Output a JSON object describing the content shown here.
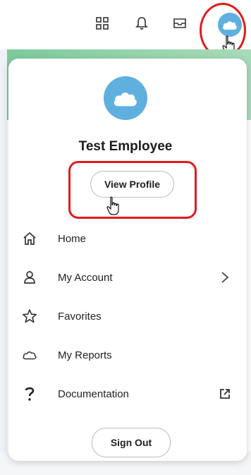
{
  "header": {
    "icons": [
      "apps-grid-icon",
      "bell-icon",
      "inbox-icon",
      "cloud-avatar-icon"
    ]
  },
  "profile": {
    "name": "Test Employee",
    "view_profile_label": "View Profile"
  },
  "menu": {
    "items": [
      {
        "label": "Home",
        "icon": "home-icon"
      },
      {
        "label": "My Account",
        "icon": "person-icon",
        "trailing": "chevron-right-icon"
      },
      {
        "label": "Favorites",
        "icon": "star-icon"
      },
      {
        "label": "My Reports",
        "icon": "cloud-outline-icon"
      },
      {
        "label": "Documentation",
        "icon": "question-mark-icon",
        "trailing": "external-link-icon"
      }
    ]
  },
  "footer": {
    "sign_out_label": "Sign Out"
  },
  "colors": {
    "avatar": "#5fb0df",
    "highlight": "#e11c1c"
  }
}
